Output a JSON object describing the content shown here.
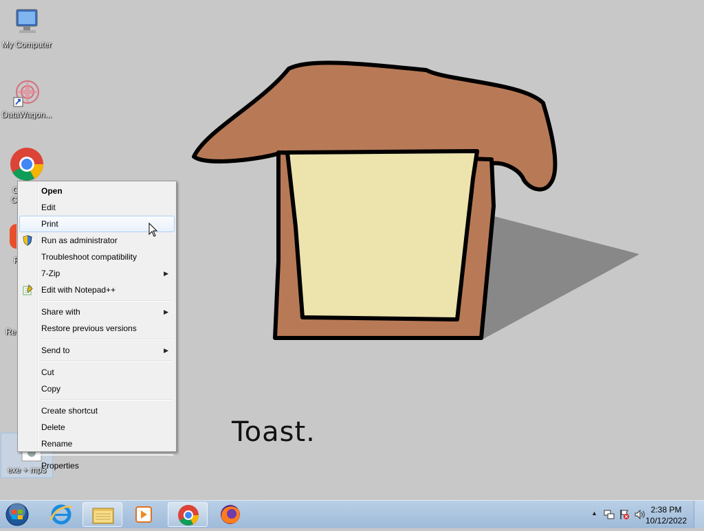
{
  "desktop": {
    "icons": [
      {
        "label": "My Computer"
      },
      {
        "label": "DataWagon..."
      },
      {
        "label": "exe + mp3"
      }
    ],
    "partial_labels": [
      "C",
      "C",
      "R",
      "Re"
    ],
    "wallpaper_caption": "Toast."
  },
  "context_menu": {
    "items": {
      "open": "Open",
      "edit": "Edit",
      "print": "Print",
      "run_as_admin": "Run as administrator",
      "troubleshoot": "Troubleshoot compatibility",
      "seven_zip": "7-Zip",
      "edit_notepad": "Edit with Notepad++",
      "share_with": "Share with",
      "restore": "Restore previous versions",
      "send_to": "Send to",
      "cut": "Cut",
      "copy": "Copy",
      "create_shortcut": "Create shortcut",
      "delete": "Delete",
      "rename": "Rename",
      "properties": "Properties"
    },
    "submenu_arrow": "▶"
  },
  "taskbar": {
    "time": "2:38 PM",
    "date": "10/12/2022",
    "tray_expand": "▲",
    "pinned_icons": [
      "start-orb-icon",
      "internet-explorer-icon",
      "file-explorer-icon",
      "media-player-icon",
      "chrome-icon",
      "firefox-icon"
    ]
  },
  "colors": {
    "desktop_bg": "#c8c8c8",
    "toast_crust": "#b87a56",
    "toast_inner": "#ede3ad",
    "shadow": "#8a8a8a",
    "menu_hover": "#e8f1fb"
  }
}
